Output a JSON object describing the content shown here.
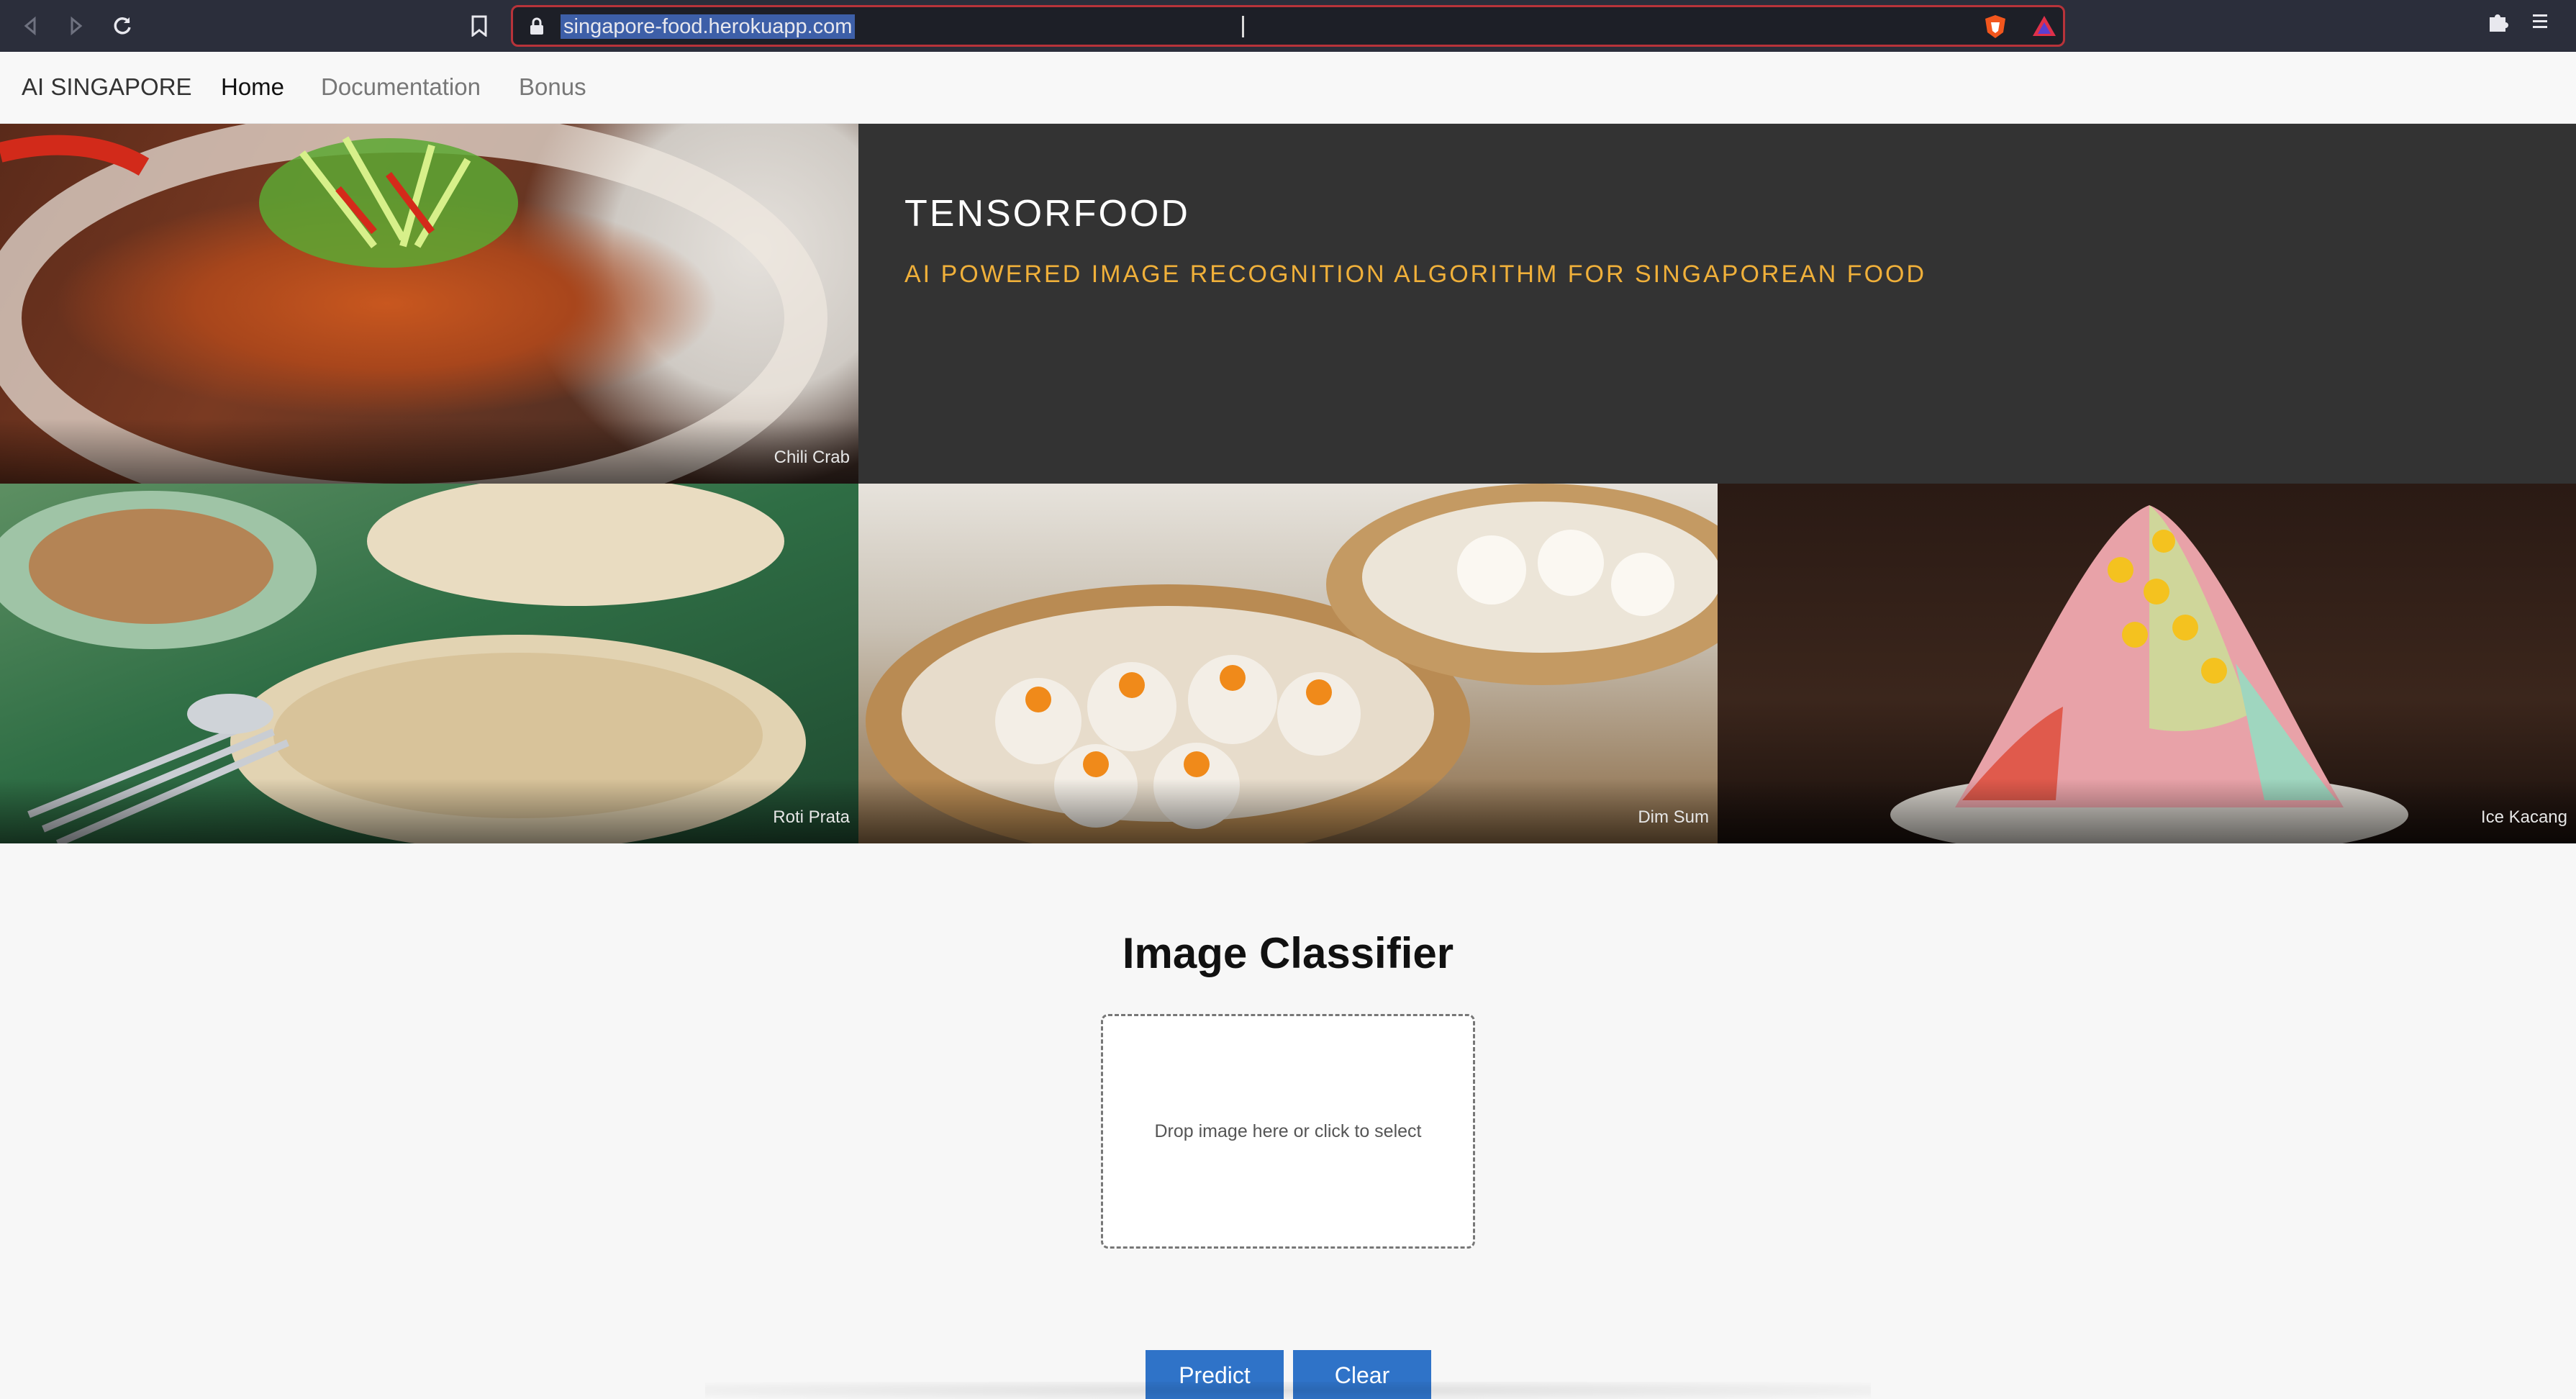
{
  "browser": {
    "url": "singapore-food.herokuapp.com",
    "icons": [
      "back-icon",
      "forward-icon",
      "reload-icon",
      "bookmark-icon",
      "lock-icon",
      "brave-shield-icon",
      "brave-rewards-icon",
      "extensions-icon",
      "menu-icon"
    ]
  },
  "nav": {
    "brand": "AI SINGAPORE",
    "links": [
      "Home",
      "Documentation",
      "Bonus"
    ],
    "active": "Home"
  },
  "hero": {
    "title": "TENSORFOOD",
    "subtitle": "AI POWERED IMAGE RECOGNITION ALGORITHM FOR SINGAPOREAN FOOD",
    "tiles": [
      "Chili Crab",
      "Roti Prata",
      "Dim Sum",
      "Ice Kacang"
    ]
  },
  "classifier": {
    "title": "Image Classifier",
    "dropzone_text": "Drop image here or click to select",
    "predict_label": "Predict",
    "clear_label": "Clear"
  },
  "colors": {
    "browser_chrome": "#2b2e3b",
    "url_focus_border": "#b8333a",
    "banner_bg": "#333333",
    "subtitle": "#f0b03a",
    "button": "#2f73c8"
  }
}
